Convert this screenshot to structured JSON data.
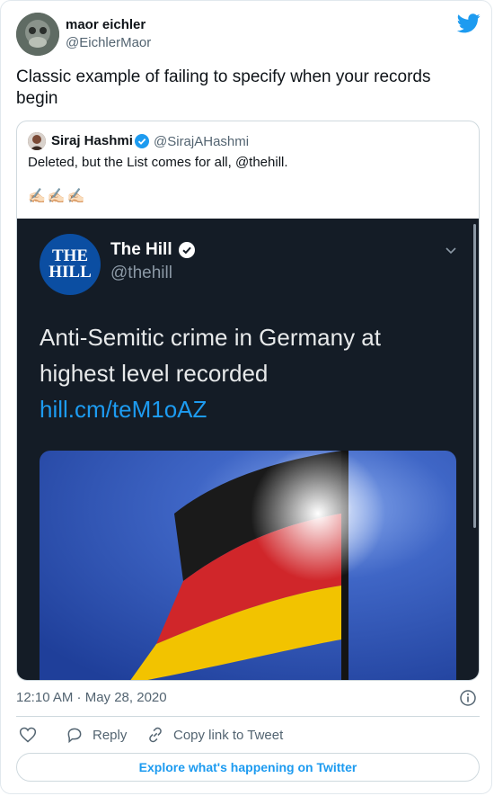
{
  "tweet": {
    "author_name": "maor eichler",
    "author_handle": "@EichlerMaor",
    "text": "Classic example of failing to specify when your records begin",
    "timestamp": "12:10 AM · May 28, 2020"
  },
  "quoted": {
    "author_name": "Siraj Hashmi",
    "author_handle": "@SirajAHashmi",
    "text": "Deleted, but the List comes for all, @thehill.",
    "emoji": "✍🏻✍🏻✍🏻",
    "media": {
      "logo_line1": "THE",
      "logo_line2": "HILL",
      "name": "The Hill",
      "handle": "@thehill",
      "text": "Anti-Semitic crime in Germany at highest level recorded ",
      "link": "hill.cm/teM1oAZ",
      "image_subject": "german-flag"
    }
  },
  "actions": {
    "reply_label": "Reply",
    "copy_link_label": "Copy link to Tweet",
    "explore_label": "Explore what's happening on Twitter"
  },
  "colors": {
    "accent": "#1d9bf0",
    "secondary_text": "#536471",
    "media_background": "#141c26"
  }
}
